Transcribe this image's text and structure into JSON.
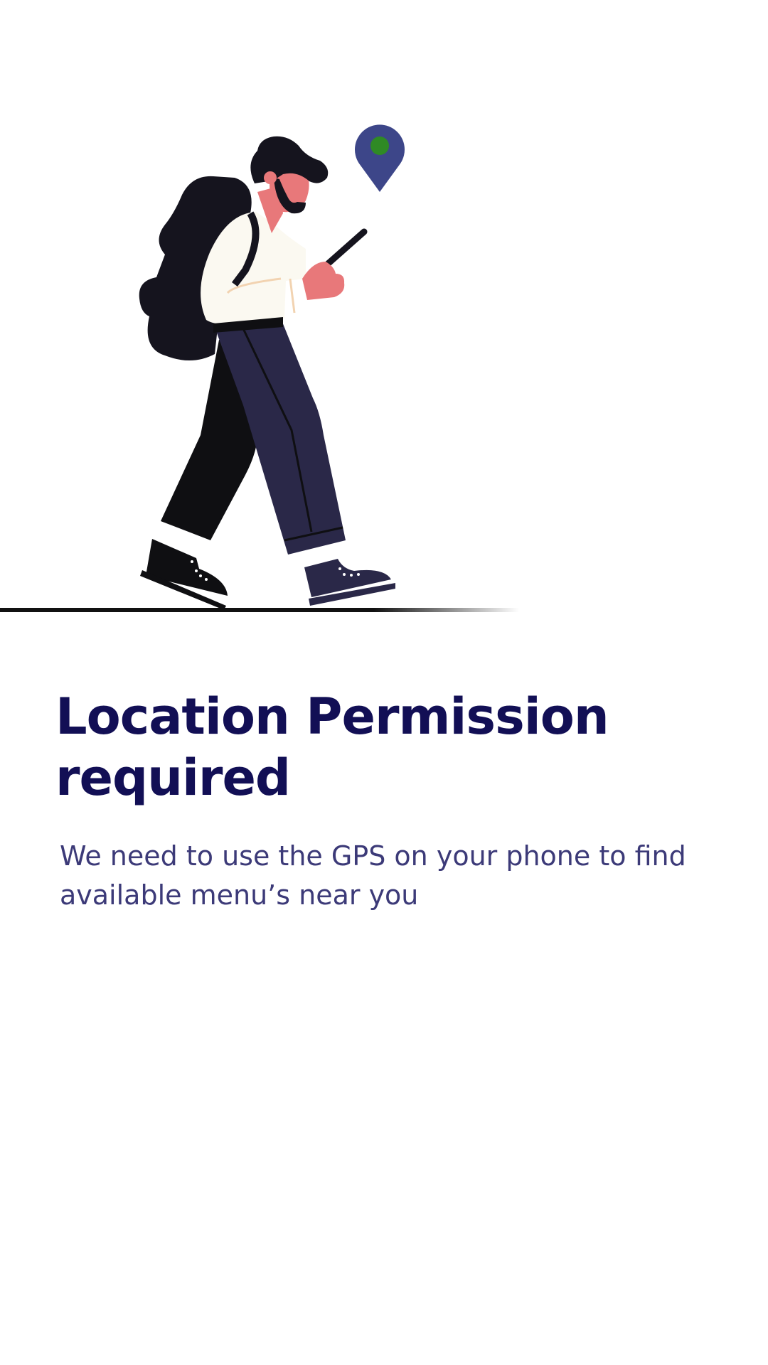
{
  "screen": {
    "title": "Location Permission required",
    "subtitle": "We need to use the GPS on your phone to find available menu’s near you"
  },
  "illustration": {
    "person_icon": "person-walking-with-phone-icon",
    "pin_icon": "location-pin-icon",
    "colors": {
      "pin": "#3d4689",
      "pin_dot": "#2f8a25",
      "skin": "#e8787a",
      "hair": "#15141e",
      "shirt": "#fbf9f1",
      "pants": "#2a2848",
      "ground": "#111111"
    }
  },
  "colors": {
    "title": "#120f55",
    "subtitle": "#3c3a78",
    "background": "#ffffff"
  }
}
